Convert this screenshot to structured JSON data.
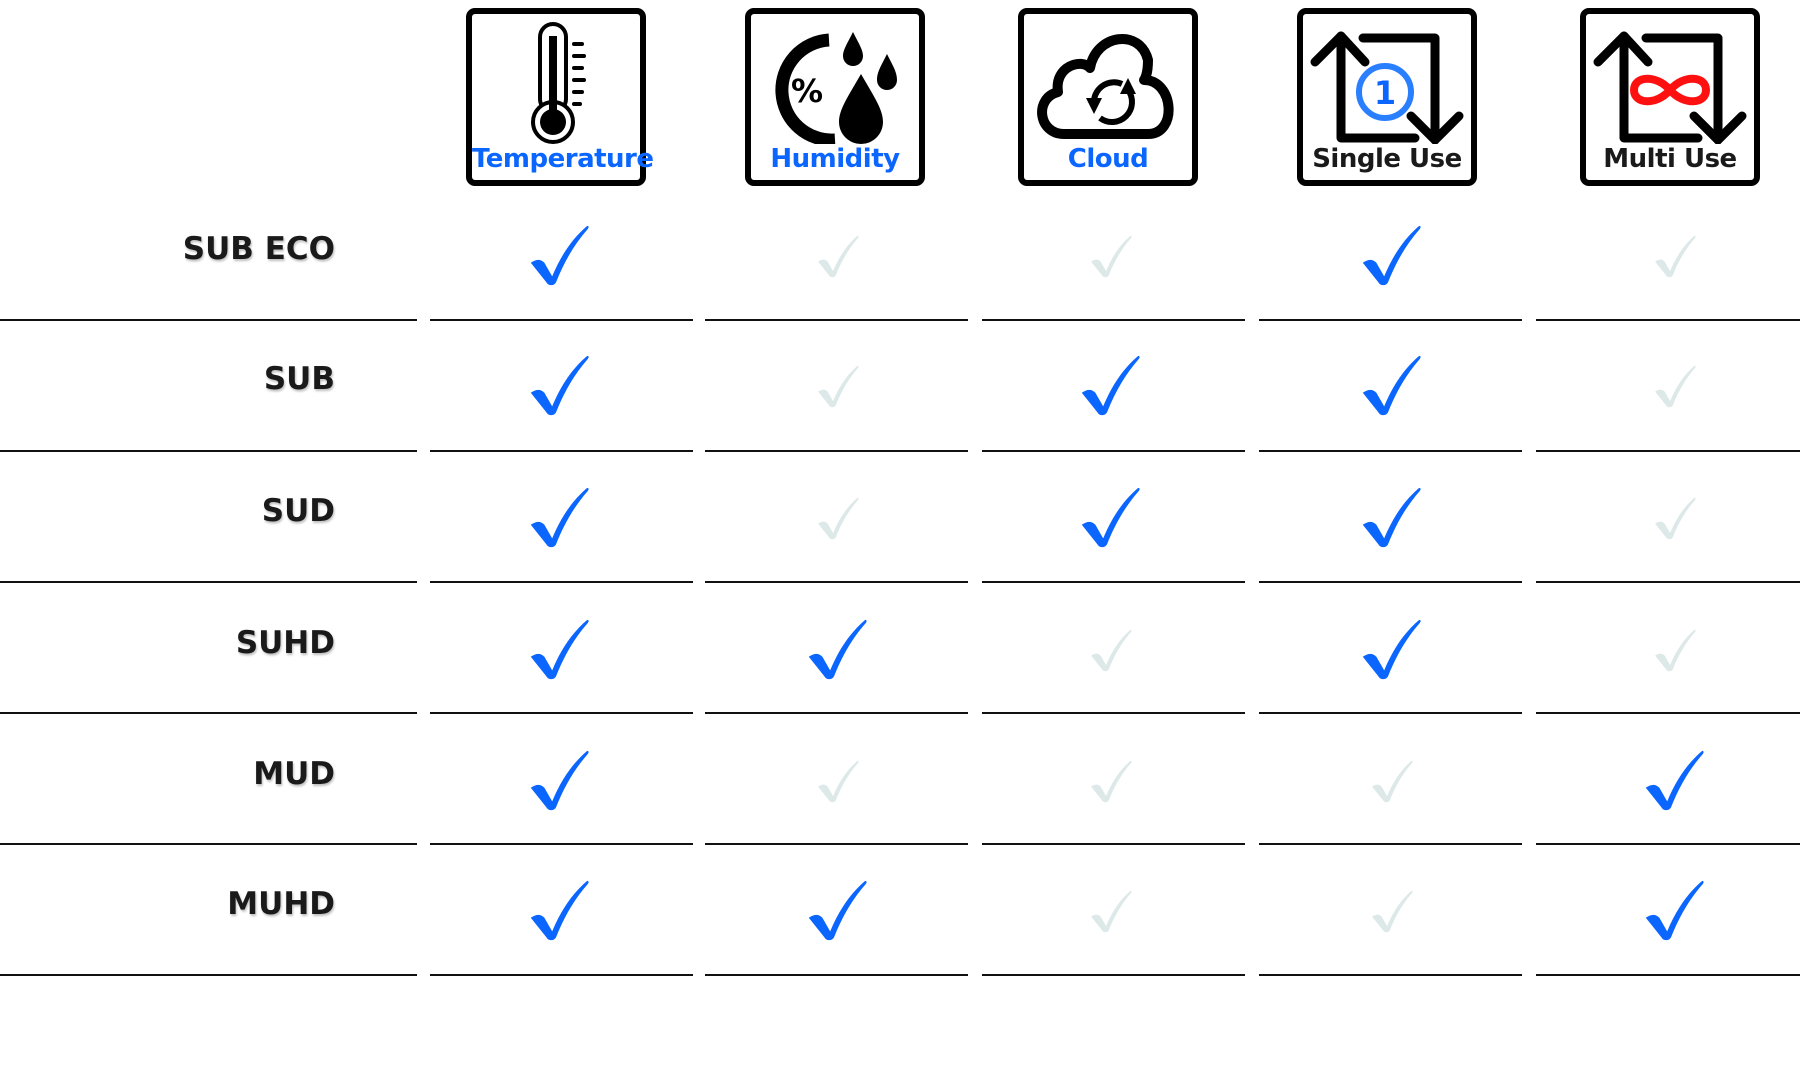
{
  "colors": {
    "check_on": "#0a66ff",
    "check_off": "#dde8e8",
    "label_blue": "#0a66ff",
    "infinity_red": "#ff1010"
  },
  "columns": [
    {
      "label": "Temperature",
      "icon": "thermometer-icon",
      "label_color": "#0a66ff"
    },
    {
      "label": "Humidity",
      "icon": "humidity-icon",
      "label_color": "#0a66ff"
    },
    {
      "label": "Cloud",
      "icon": "cloud-sync-icon",
      "label_color": "#0a66ff"
    },
    {
      "label": "Single Use",
      "icon": "single-use-icon",
      "label_color": "#1a1a1a"
    },
    {
      "label": "Multi Use",
      "icon": "multi-use-icon",
      "label_color": "#1a1a1a"
    }
  ],
  "rows": [
    {
      "label": "SUB ECO",
      "values": [
        true,
        false,
        false,
        true,
        false
      ]
    },
    {
      "label": "SUB",
      "values": [
        true,
        false,
        true,
        true,
        false
      ]
    },
    {
      "label": "SUD",
      "values": [
        true,
        false,
        true,
        true,
        false
      ]
    },
    {
      "label": "SUHD",
      "values": [
        true,
        true,
        false,
        true,
        false
      ]
    },
    {
      "label": "MUD",
      "values": [
        true,
        false,
        false,
        false,
        true
      ]
    },
    {
      "label": "MUHD",
      "values": [
        true,
        true,
        false,
        false,
        true
      ]
    }
  ]
}
